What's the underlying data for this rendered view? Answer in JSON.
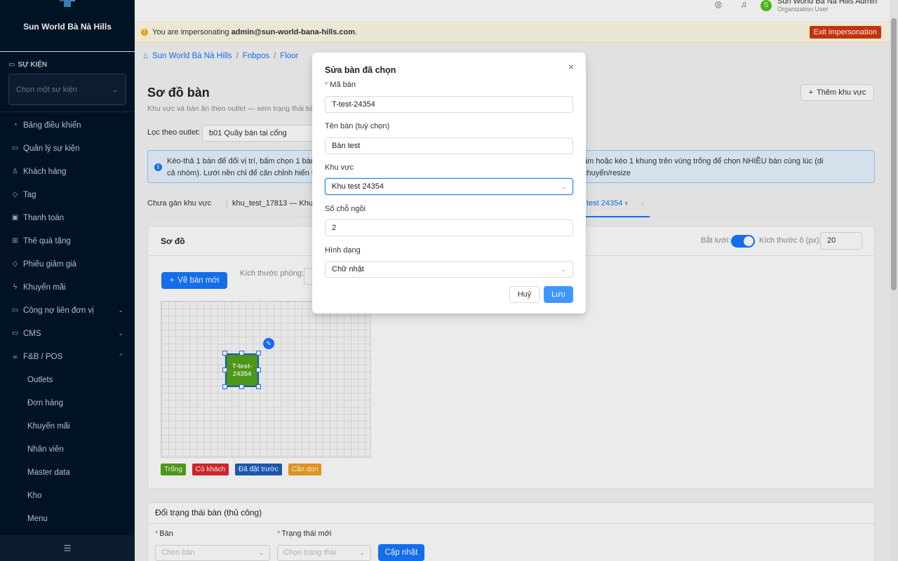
{
  "sidebar": {
    "brand": "Sun World Bà Nà Hills",
    "event_section": "SỰ KIỆN",
    "event_placeholder": "Chọn một sự kiện",
    "menu": [
      {
        "label": "Bảng điều khiển",
        "icon": "dashboard-icon"
      },
      {
        "label": "Quản lý sự kiện",
        "icon": "calendar-icon"
      },
      {
        "label": "Khách hàng",
        "icon": "users-icon"
      },
      {
        "label": "Tag",
        "icon": "tag-icon"
      },
      {
        "label": "Thanh toán",
        "icon": "payment-icon"
      },
      {
        "label": "Thẻ quà tặng",
        "icon": "gift-icon"
      },
      {
        "label": "Phiếu giảm giá",
        "icon": "coupon-icon"
      },
      {
        "label": "Khuyến mãi",
        "icon": "promo-icon"
      },
      {
        "label": "Công nợ liên đơn vị",
        "icon": "debt-icon"
      },
      {
        "label": "CMS",
        "icon": "cms-icon"
      },
      {
        "label": "F&B / POS",
        "icon": "fnb-icon"
      }
    ],
    "submenu": [
      "Outlets",
      "Đơn hàng",
      "Khuyến mãi",
      "Nhân viên",
      "Master data",
      "Kho",
      "Menu"
    ]
  },
  "topbar": {
    "user_name": "Sun World Bà Nà Hills Admin",
    "user_role": "Organization User",
    "avatar_letter": "S"
  },
  "banner": {
    "prefix": "You are impersonating",
    "email": "admin@sun-world-bana-hills.com",
    "suffix": ".",
    "exit_label": "Exit impersonation"
  },
  "breadcrumb": [
    "Sun World Bà Nà Hills",
    "Fnbpos",
    "Floor"
  ],
  "page": {
    "title": "Sơ đồ bàn",
    "subtitle": "Khu vực và bàn ăn theo outlet — xem trạng thái bà",
    "add_zone": "Thêm khu vực",
    "filter_label": "Lọc theo outlet:",
    "filter_value": "b01 Quầy bán tại cổng",
    "info_left_1": "Kéo-thả 1 bàn để đổi vị trí, bấm chọn 1 bàn đ",
    "info_left_2": "cả nhóm). Lưới nền chỉ để căn chỉnh hiển thị,",
    "info_right": "ấm hoặc kéo 1 khung trên vùng trống để chọn NHIỀU bàn cùng lúc (di chuyển/resize",
    "tabs": {
      "unassigned": "Chưa gán khu vực",
      "tab1": "khu_test_17813 — Khu te",
      "active": "test 24354"
    }
  },
  "floorcard": {
    "title": "Sơ đồ",
    "grid_label": "Bắt lưới:",
    "cell_label": "Kích thước ô (px):",
    "cell_value": "20",
    "draw_button": "Vẽ bàn mới",
    "room_label": "Kích thước phòng:",
    "table_label": "T-test-24354"
  },
  "legend": [
    {
      "label": "Trống",
      "color": "#52a41a"
    },
    {
      "label": "Có khách",
      "color": "#e0282e"
    },
    {
      "label": "Đã đặt trước",
      "color": "#1e5fbf"
    },
    {
      "label": "Cần dọn",
      "color": "#f0a020"
    }
  ],
  "status_card": {
    "title": "Đổi trạng thái bàn (thủ công)",
    "table_label": "Bàn",
    "table_placeholder": "Chọn bàn",
    "status_label": "Trạng thái mới",
    "status_placeholder": "Chọn trạng thái",
    "update_button": "Cập nhật"
  },
  "modal": {
    "title": "Sửa bàn đã chọn",
    "code_label": "Mã bàn",
    "code_value": "T-test-24354",
    "name_label": "Tên bàn (tuỳ chọn)",
    "name_value": "Bàn test",
    "zone_label": "Khu vực",
    "zone_value": "Khu test 24354",
    "seats_label": "Số chỗ ngồi",
    "seats_value": "2",
    "shape_label": "Hình dạng",
    "shape_value": "Chữ nhật",
    "cancel": "Huỷ",
    "save": "Lưu"
  }
}
